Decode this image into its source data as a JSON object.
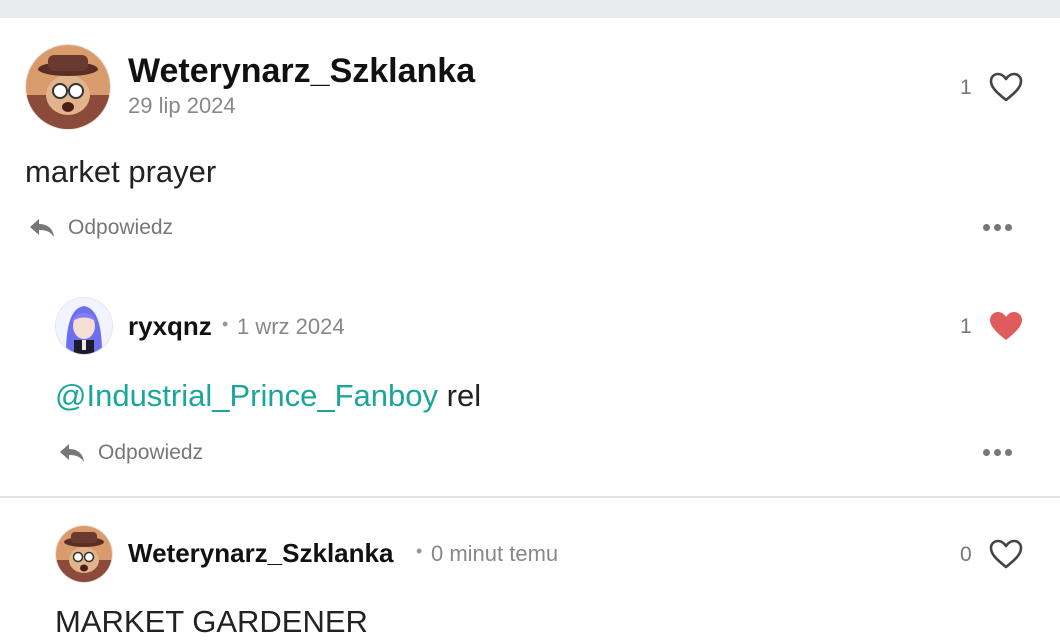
{
  "comments": [
    {
      "username": "Weterynarz_Szklanka",
      "date": "29 lip 2024",
      "text": "market prayer",
      "likes": "1",
      "liked": false,
      "reply_label": "Odpowiedz"
    },
    {
      "username": "ryxqnz",
      "separator": "•",
      "date": "1 wrz 2024",
      "mention": "@Industrial_Prince_Fanboy",
      "text": " rel",
      "likes": "1",
      "liked": true,
      "reply_label": "Odpowiedz"
    },
    {
      "username": "Weterynarz_Szklanka",
      "separator": "•",
      "date": "0 minut temu",
      "text": "MARKET GARDENER",
      "likes": "0",
      "liked": false
    }
  ],
  "colors": {
    "mention": "#1aa79a",
    "liked_heart": "#e05b5b",
    "muted": "#777777"
  }
}
